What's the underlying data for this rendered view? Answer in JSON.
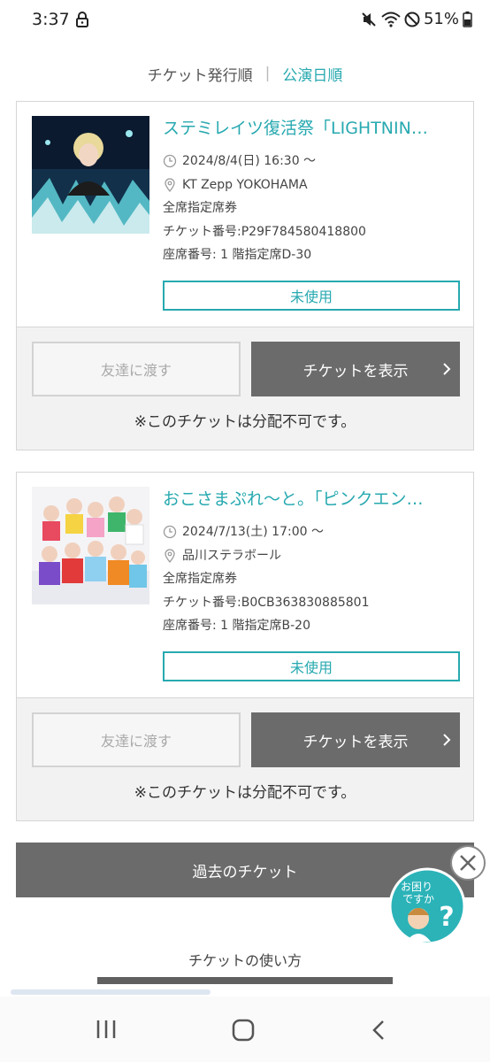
{
  "status_bar": {
    "time": "3:37",
    "battery": "51%",
    "icons": [
      "lock-icon",
      "mute-icon",
      "wifi-icon",
      "do-not-disturb-icon",
      "battery-icon"
    ]
  },
  "sort": {
    "option_issue": "チケット発行順",
    "divider": "|",
    "option_date": "公演日順",
    "active": "公演日順"
  },
  "tickets": [
    {
      "title": "ステミレイツ復活祭「LIGHTNIN…",
      "datetime": "2024/8/4(日) 16:30 〜",
      "venue": "KT Zepp YOKOHAMA",
      "seat_type": "全席指定席券",
      "ticket_number": "チケット番号:P29F784580418800",
      "seat_number": "座席番号: 1 階指定席D-30",
      "status": "未使用",
      "transfer_label": "友達に渡す",
      "show_label": "チケットを表示",
      "note": "※このチケットは分配不可です。"
    },
    {
      "title": "おこさまぷれ〜と。「ピンクエン…",
      "datetime": "2024/7/13(土) 17:00 〜",
      "venue": "品川ステラボール",
      "seat_type": "全席指定席券",
      "ticket_number": "チケット番号:B0CB363830885801",
      "seat_number": "座席番号: 1 階指定席B-20",
      "status": "未使用",
      "transfer_label": "友達に渡す",
      "show_label": "チケットを表示",
      "note": "※このチケットは分配不可です。"
    }
  ],
  "past_tickets_label": "過去のチケット",
  "help_badge": {
    "line1": "お困り",
    "line2": "ですか"
  },
  "usage_title": "チケットの使い方",
  "colors": {
    "accent": "#27a9b0",
    "button_dark": "#6b6b6b",
    "card_bottom": "#f2f2f2"
  }
}
